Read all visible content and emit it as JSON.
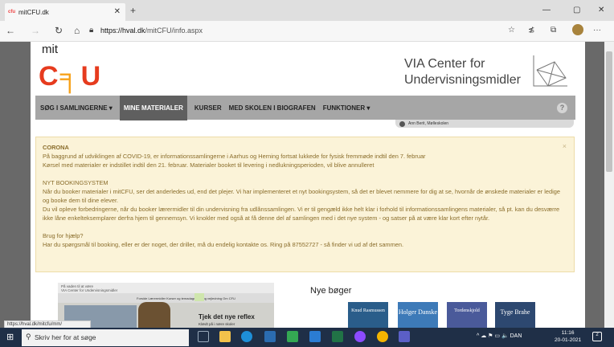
{
  "browser": {
    "favicon_text": "cfu",
    "tab_title": "mitCFU.dk",
    "new_tab_icon": "plus-icon",
    "url_host": "https://hval.dk",
    "url_path": "/mitCFU/info.aspx",
    "status_url": "https://hval.dk/mitcfu/mm/"
  },
  "header": {
    "logo_mit": "mit",
    "logo_c": "C",
    "logo_f": "╕",
    "logo_u": "U",
    "via_line1": "VIA Center for",
    "via_line2": "Undervisningsmidler"
  },
  "nav": {
    "items": [
      {
        "label": "SØG I SAMLINGERNE ▾"
      },
      {
        "label": "MINE MATERIALER"
      },
      {
        "label": "KURSER"
      },
      {
        "label": "MED SKOLEN I BIOGRAFEN"
      },
      {
        "label": "FUNKTIONER ▾"
      }
    ],
    "help_label": "?",
    "user": "Ann Berit, Mølleskolen"
  },
  "alert": {
    "close_label": "×",
    "title1": "CORONA",
    "p1_l1": "På baggrund af udviklingen af COVID-19, er informationssamlingerne i Aarhus og Herning fortsat lukkede for fysisk fremmøde indtil den 7. februar",
    "p1_l2": "Kørsel med materialer er indstillet indtil den 21. februar. Materialer booket til levering i nedlukningsperioden, vil blive annulleret",
    "title2": "NYT BOOKINGSYSTEM",
    "p2": "Når du booker materialer i mitCFU, ser det anderledes ud, end det plejer. Vi har implementeret et nyt bookingsystem, så det er blevet nemmere for dig at se, hvornår de ønskede materialer er ledige og booke dem til dine elever.",
    "p3": "Du vil opleve forbedringerne, når du booker lærermidler til din undervisning fra udlånssamlingen. Vi er til gengæld ikke helt klar i forhold til informationssamlingens materialer, så pt. kan du desværre ikke låne enkelteksemplarer derfra hjem til gennemsyn. Vi knokler med også at få denne del af samlingen med i det nye system - og satser på at være klar kort efter nytår.",
    "title3": "Brug for hjælp?",
    "p4": "Har du spørgsmål til booking, eller er der noget, der driller, må du endelig kontakte os. Ring på 87552727 - så finder vi ud af det sammen."
  },
  "promo": {
    "top_line1": "På vaden til at være",
    "top_line2": "VIA Center for Undervisningsmidler",
    "menu": "Forside    Lærermidler    Kurser og temadage    Fag og vejledning    Om CFU",
    "title": "Tjek det nye reflex",
    "subtitle": "Klædt på i nære skoler"
  },
  "books": {
    "heading": "Nye bøger",
    "items": [
      {
        "title": "Knud Rasmussen"
      },
      {
        "title": "Holger Danske"
      },
      {
        "title": "Tordenskjold"
      },
      {
        "title": "Tyge Brahe"
      }
    ]
  },
  "taskbar": {
    "search_placeholder": "Skriv her for at søge",
    "tray_text": "^  ☁  ⚑  ▭  🔈  DAN",
    "time": "11:16",
    "date": "20-01-2021",
    "notif_count": "2"
  },
  "colors": {
    "cfu_red": "#e63b1e",
    "cfu_orange": "#f7a21b",
    "nav_bg": "#a6a6a6",
    "nav_active": "#5f5f5f",
    "alert_bg": "#fbf3d8",
    "alert_text": "#8a6d2b",
    "taskbar": "#1f2f47"
  }
}
